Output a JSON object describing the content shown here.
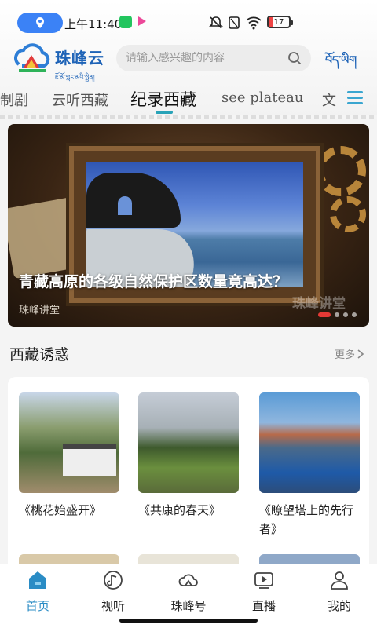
{
  "status_bar": {
    "time": "上午11:40",
    "battery": "17"
  },
  "header": {
    "brand_name": "珠峰云",
    "brand_sub": "ཇོ་མོ་གླང་མའི་སྤྲིན།",
    "search_placeholder": "请输入感兴趣的内容",
    "tibetan_toggle": "བོད་ཡིག"
  },
  "tabs": [
    "制剧",
    "云听西藏",
    "纪录西藏",
    "see plateau",
    "文"
  ],
  "active_tab": "纪录西藏",
  "banner": {
    "title": "青藏高原的各级自然保护区数量竟高达？",
    "source": "珠峰讲堂",
    "watermark": "珠峰讲堂"
  },
  "section": {
    "title": "西藏诱惑",
    "more": "更多"
  },
  "items": [
    {
      "label": "《桃花始盛开》"
    },
    {
      "label": "《共康的春天》"
    },
    {
      "label": "《瞭望塔上的先行者》"
    }
  ],
  "bottom_nav": [
    {
      "label": "首页",
      "icon": "home-icon"
    },
    {
      "label": "视听",
      "icon": "music-icon"
    },
    {
      "label": "珠峰号",
      "icon": "cloud-icon"
    },
    {
      "label": "直播",
      "icon": "live-icon"
    },
    {
      "label": "我的",
      "icon": "user-icon"
    }
  ],
  "colors": {
    "brand": "#1e63b7",
    "accent": "#2a8cc5",
    "tab_indicator": "#28a3b8"
  }
}
